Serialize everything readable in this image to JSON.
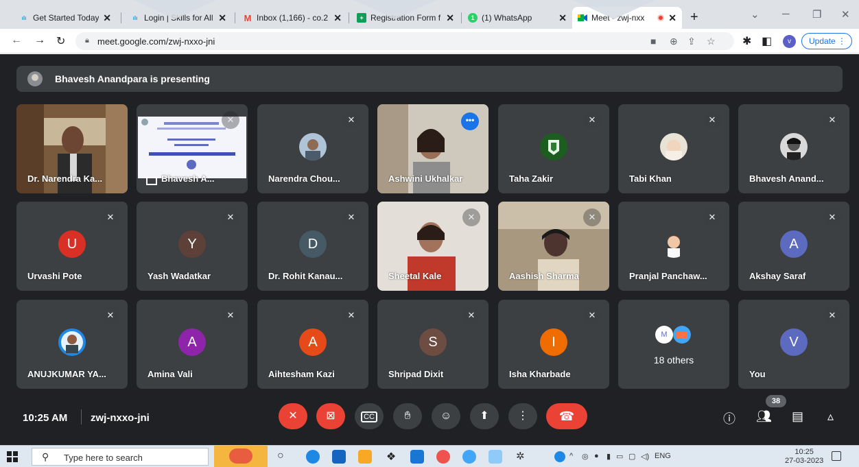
{
  "browser": {
    "tabs": [
      {
        "title": "Get Started Today |",
        "icon": "cisco-icon",
        "active": false
      },
      {
        "title": "Login | Skills for All",
        "icon": "cisco-icon",
        "active": false
      },
      {
        "title": "Inbox (1,166) - co.2",
        "icon": "gmail-icon",
        "active": false
      },
      {
        "title": "Registration Form f",
        "icon": "google-forms-icon",
        "active": false
      },
      {
        "title": "(1) WhatsApp",
        "icon": "whatsapp-icon",
        "active": false
      },
      {
        "title": "Meet - zwj-nxx",
        "icon": "google-meet-icon",
        "active": true
      }
    ],
    "url": "meet.google.com/zwj-nxxo-jni",
    "profile_initial": "v",
    "update_label": "Update"
  },
  "meet": {
    "banner": "Bhavesh Anandpara is presenting",
    "tiles": [
      {
        "name": "Dr. Narendra Ka...",
        "type": "video"
      },
      {
        "name": "Bhavesh A...",
        "type": "presentation"
      },
      {
        "name": "Narendra Chou...",
        "type": "photo"
      },
      {
        "name": "Ashwini Ukhalkar",
        "type": "video"
      },
      {
        "name": "Taha Zakir",
        "type": "photo"
      },
      {
        "name": "Tabi Khan",
        "type": "photo"
      },
      {
        "name": "Bhavesh Anand...",
        "type": "photo"
      },
      {
        "name": "Urvashi Pote",
        "initial": "U",
        "color": "#d93025"
      },
      {
        "name": "Yash Wadatkar",
        "initial": "Y",
        "color": "#5d4037"
      },
      {
        "name": "Dr. Rohit Kanau...",
        "initial": "D",
        "color": "#455a64"
      },
      {
        "name": "Sheetal Kale",
        "type": "video"
      },
      {
        "name": "Aashish Sharma",
        "type": "video"
      },
      {
        "name": "Pranjal Panchaw...",
        "type": "photo"
      },
      {
        "name": "Akshay Saraf",
        "initial": "A",
        "color": "#5c6bc0"
      },
      {
        "name": "ANUJKUMAR YA...",
        "type": "photo"
      },
      {
        "name": "Amina Vali",
        "initial": "A",
        "color": "#8e24aa"
      },
      {
        "name": "Aihtesham Kazi",
        "initial": "A",
        "color": "#e64a19"
      },
      {
        "name": "Shripad Dixit",
        "initial": "S",
        "color": "#6d4c41"
      },
      {
        "name": "Isha Kharbade",
        "initial": "I",
        "color": "#ef6c00"
      },
      {
        "name": "18 others",
        "initial": "M",
        "color": "#ffffff"
      },
      {
        "name": "You",
        "initial": "V",
        "color": "#5c6bc0"
      }
    ],
    "time": "10:25 AM",
    "meeting_code": "zwj-nxxo-jni",
    "participant_count": "38"
  },
  "taskbar": {
    "search_placeholder": "Type here to search",
    "lang": "ENG",
    "clock_time": "10:25",
    "clock_date": "27-03-2023"
  }
}
